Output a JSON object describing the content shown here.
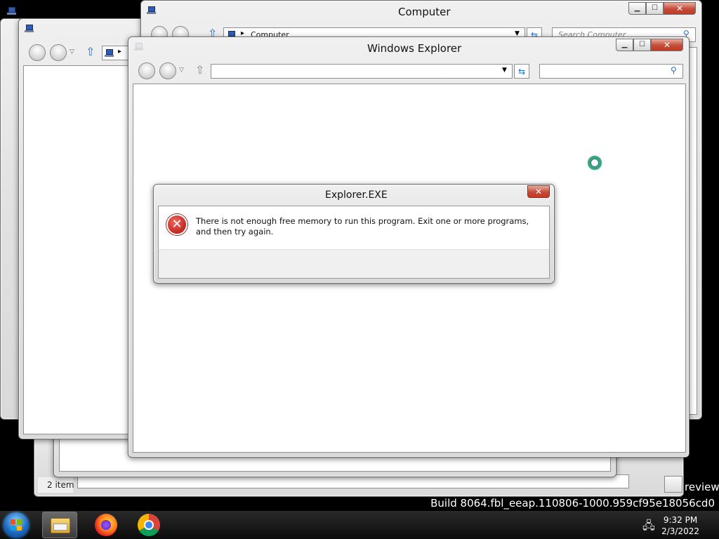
{
  "windows": {
    "back_left": {
      "status_text": "2 item"
    },
    "computer": {
      "title": "Computer",
      "breadcrumb": "Computer",
      "search_placeholder": "Search Computer"
    },
    "explorer": {
      "title": "Windows Explorer",
      "address_value": "",
      "search_value": ""
    }
  },
  "dialog": {
    "title": "Explorer.EXE",
    "message": "There is not enough free memory to run this program. Exit one or more programs, and then try again.",
    "icon": "error-icon"
  },
  "desktop": {
    "watermark_preview": "review",
    "build_string": "Build 8064.fbl_eeap.110806-1000.959cf95e18056cd0"
  },
  "taskbar": {
    "items": [
      {
        "name": "start-orb-icon"
      },
      {
        "name": "windows-explorer-icon"
      },
      {
        "name": "firefox-icon"
      },
      {
        "name": "chrome-icon"
      }
    ],
    "clock_time": "9:32 PM",
    "clock_date": "2/3/2022"
  },
  "colors": {
    "close_button": "#c64a37",
    "error_red": "#c8302a",
    "accent_blue": "#2f5db5"
  }
}
